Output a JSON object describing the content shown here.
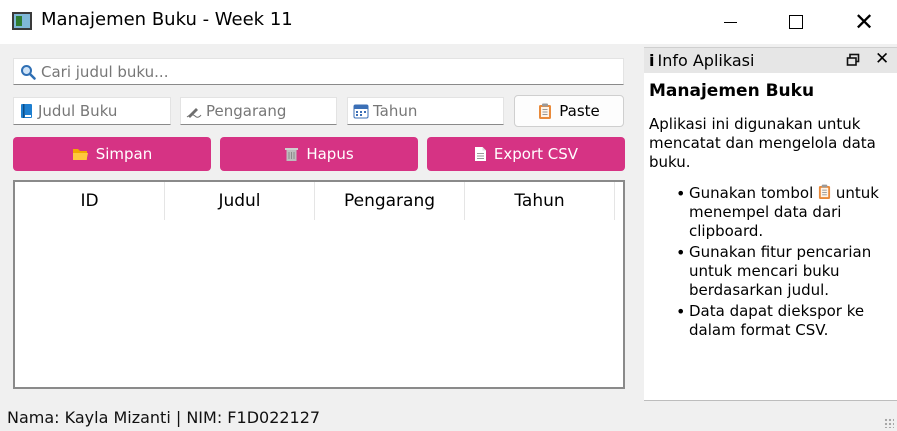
{
  "window": {
    "title": "Manajemen Buku - Week 11"
  },
  "search": {
    "placeholder": "Cari judul buku..."
  },
  "inputs": {
    "judul_placeholder": "Judul Buku",
    "pengarang_placeholder": "Pengarang",
    "tahun_placeholder": "Tahun"
  },
  "buttons": {
    "paste": "Paste",
    "simpan": "Simpan",
    "hapus": "Hapus",
    "export": "Export CSV"
  },
  "table": {
    "columns": [
      "ID",
      "Judul",
      "Pengarang",
      "Tahun"
    ],
    "rows": []
  },
  "status": {
    "text": "Nama: Kayla Mizanti | NIM: F1D022127"
  },
  "dock": {
    "title": "Info Aplikasi",
    "heading": "Manajemen Buku",
    "description": "Aplikasi ini digunakan untuk mencatat dan mengelola data buku.",
    "bullets": {
      "paste_before": "Gunakan tombol",
      "paste_after": "untuk menempel data dari clipboard.",
      "search": "Gunakan fitur pencarian untuk mencari buku berdasarkan judul.",
      "export": "Data dapat diekspor ke dalam format CSV."
    }
  },
  "colors": {
    "accent": "#d63384",
    "dock_header": "#e6e6e6",
    "background": "#f0f0f0"
  },
  "icons": [
    "app-icon",
    "search-icon",
    "book-icon",
    "pen-icon",
    "calendar-icon",
    "clipboard-icon",
    "folder-icon",
    "trash-icon",
    "document-icon",
    "info-icon",
    "float-icon",
    "close-icon"
  ]
}
